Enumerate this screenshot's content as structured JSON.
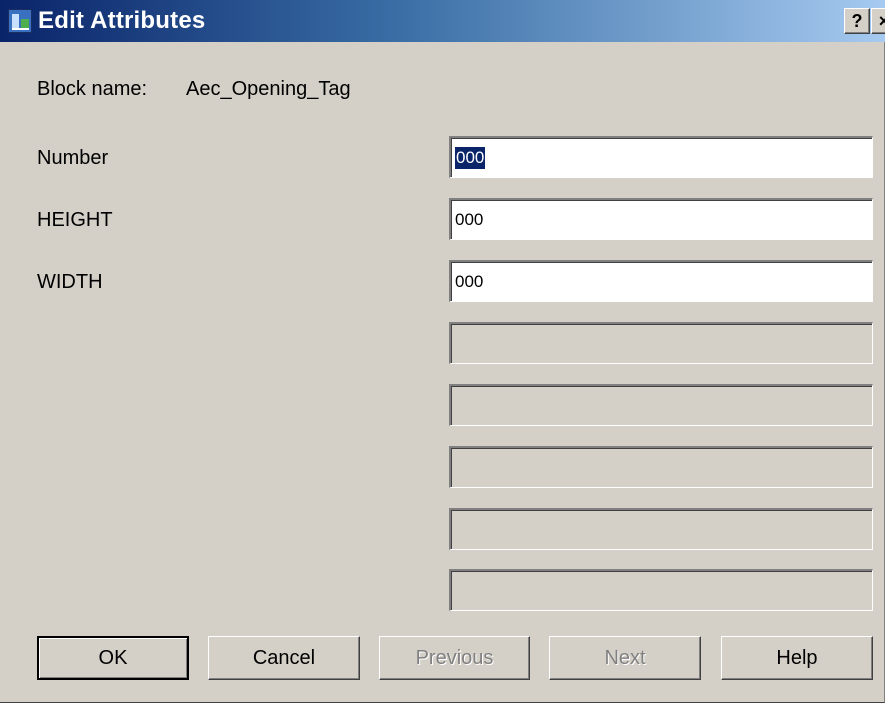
{
  "window": {
    "title": "Edit Attributes",
    "help_button": "?",
    "close_button": "×",
    "icon": "autocad-app-icon"
  },
  "block": {
    "label": "Block name:",
    "value": "Aec_Opening_Tag"
  },
  "attributes": [
    {
      "label": "Number",
      "value": "000",
      "selected": true
    },
    {
      "label": "HEIGHT",
      "value": "000"
    },
    {
      "label": "WIDTH",
      "value": "000"
    },
    {
      "label": "",
      "value": "",
      "disabled": true
    },
    {
      "label": "",
      "value": "",
      "disabled": true
    },
    {
      "label": "",
      "value": "",
      "disabled": true
    },
    {
      "label": "",
      "value": "",
      "disabled": true
    },
    {
      "label": "",
      "value": "",
      "disabled": true
    }
  ],
  "buttons": {
    "ok": "OK",
    "cancel": "Cancel",
    "previous": "Previous",
    "next": "Next",
    "help": "Help"
  },
  "colors": {
    "titlebar_start": "#0a246a",
    "titlebar_end": "#a6caf0",
    "dialog_face": "#d4d0c8",
    "selection": "#0a246a"
  }
}
